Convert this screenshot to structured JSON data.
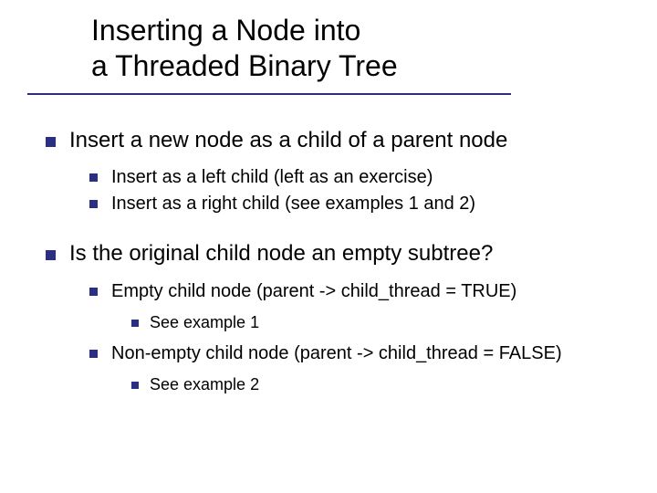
{
  "title": {
    "line1": "Inserting a Node into",
    "line2": " a Threaded Binary Tree"
  },
  "bullets": [
    {
      "text": "Insert a new node as a child of a parent node",
      "children": [
        {
          "text": "Insert as a left child (left as an exercise)"
        },
        {
          "text": "Insert as a right child (see examples 1 and 2)"
        }
      ]
    },
    {
      "text": "Is the original child node an empty subtree?",
      "children": [
        {
          "text": "Empty child node (parent -> child_thread = TRUE)",
          "children": [
            {
              "text": "See example 1"
            }
          ]
        },
        {
          "text": "Non-empty child node (parent -> child_thread = FALSE)",
          "children": [
            {
              "text": "See example 2"
            }
          ]
        }
      ]
    }
  ]
}
